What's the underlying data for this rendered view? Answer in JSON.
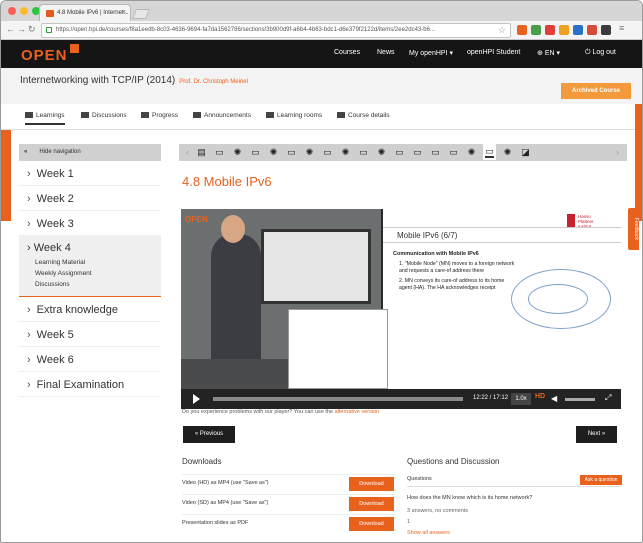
{
  "browser": {
    "tab_title": "4.8 Mobile IPv6 | Internet...",
    "url": "https://open.hpi.de/courses/f8a1eedb-8c03-4636-9694-fa7da1562786/sections/3b900d9f-a6b4-4b63-bdc1-d6e379f2122d/items/2ee2dc43-b6...",
    "ext_colors": [
      "#d85a1b",
      "#4a9d4a",
      "#e23e3e",
      "#f0a020",
      "#2b71c8"
    ]
  },
  "site": {
    "logo": "OPEN",
    "nav": [
      "Courses",
      "News",
      "My openHPI ▾",
      "openHPI Student",
      "EN ▾",
      "Log out"
    ]
  },
  "course": {
    "title": "Internetworking with TCP/IP (2014)",
    "professor": "Prof. Dr. Christoph Meinel",
    "action_button": "Archived Course",
    "tabs": [
      "Learnings",
      "Discussions",
      "Progress",
      "Announcements",
      "Learning rooms",
      "Course details"
    ]
  },
  "sidebar": {
    "hide_label": "Hide navigation",
    "weeks_top": [
      "Week 1",
      "Week 2",
      "Week 3"
    ],
    "week4": {
      "label": "Week 4",
      "sub": [
        "Learning Material",
        "Weekly Assignment",
        "Discussions"
      ]
    },
    "weeks_bottom": [
      "Extra knowledge",
      "Week 5",
      "Week 6",
      "Final Examination"
    ]
  },
  "item": {
    "title": "4.8 Mobile IPv6",
    "slide_header": "Mobile IPv6 (6/7)",
    "slide_logo": "Hasso\nPlattner\nInstitut",
    "slide_heading": "Communication with Mobile IPv6",
    "slide_points": [
      "\"Mobile Node\" (MN) moves to a foreign network and requests a care-of address there",
      "MN conveys its care-of address to its home agent (HA). The HA acknowledges receipt"
    ],
    "video_brand": "OPEN",
    "time": "12:22 / 17:12",
    "speed": "1.0x",
    "hd": "HD",
    "progress": 1.0,
    "problem_text": "Do you experience problems with our player? You can use the",
    "problem_link": "alternative version",
    "prev": "« Previous",
    "next": "Next »"
  },
  "downloads": {
    "title": "Downloads",
    "rows": [
      {
        "label": "Video (HD) as MP4 (use \"Save as\")",
        "btn": "Download"
      },
      {
        "label": "Video (SD) as MP4 (use \"Save as\")",
        "btn": "Download"
      },
      {
        "label": "Presentation slides as PDF",
        "btn": "Download"
      }
    ]
  },
  "qa": {
    "title": "Questions and Discussion",
    "sub": "Questions",
    "ask": "Ask a question",
    "question": "How does the MN know which is its home network?",
    "meta": "3 answers, no comments",
    "count": "1",
    "more": "Show all answers"
  },
  "feedback": "Feedback"
}
